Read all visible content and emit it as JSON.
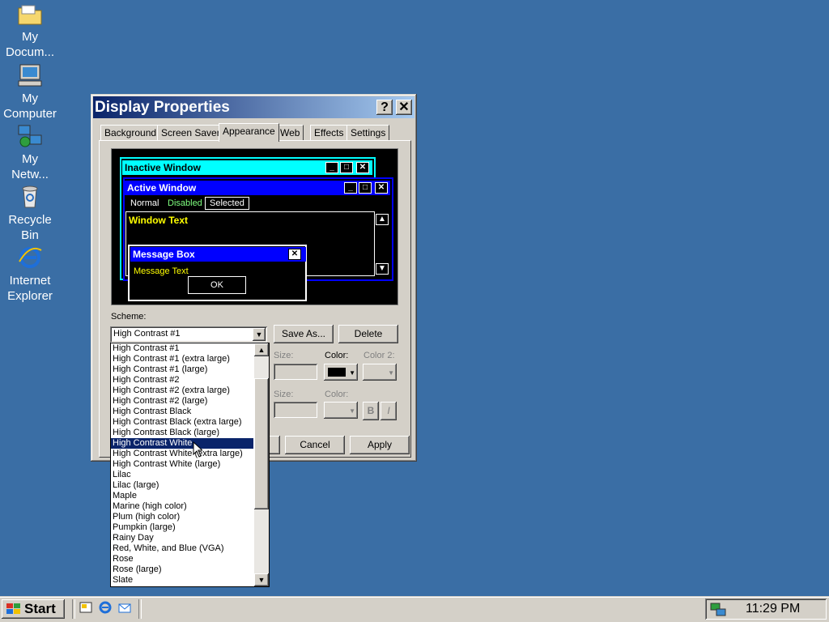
{
  "desktop": {
    "icons": [
      {
        "label_line1": "My",
        "label_line2": "Docum..."
      },
      {
        "label_line1": "My",
        "label_line2": "Computer"
      },
      {
        "label_line1": "My",
        "label_line2": "Netw..."
      },
      {
        "label_line1": "Recycle",
        "label_line2": "Bin"
      },
      {
        "label_line1": "Internet",
        "label_line2": "Explorer"
      }
    ]
  },
  "window": {
    "title": "Display Properties",
    "help_glyph": "?",
    "close_glyph": "✕",
    "tabs": [
      "Background",
      "Screen Saver",
      "Appearance",
      "Web",
      "Effects",
      "Settings"
    ],
    "active_tab": "Appearance"
  },
  "preview": {
    "inactive_title": "Inactive Window",
    "active_title": "Active Window",
    "menu_normal": "Normal",
    "menu_disabled": "Disabled",
    "menu_selected": "Selected",
    "window_text": "Window Text",
    "msgbox_title": "Message Box",
    "msgbox_text": "Message Text",
    "ok_label": "OK",
    "colors": {
      "inactive_title_bg": "#00ffff",
      "active_title_bg": "#0000ff",
      "text_yellow": "#ffff00",
      "bg": "#000000"
    }
  },
  "scheme": {
    "label": "Scheme:",
    "selected_value": "High Contrast #1",
    "save_as_label": "Save As...",
    "delete_label": "Delete",
    "options": [
      "High Contrast #1",
      "High Contrast #1 (extra large)",
      "High Contrast #1 (large)",
      "High Contrast #2",
      "High Contrast #2 (extra large)",
      "High Contrast #2 (large)",
      "High Contrast Black",
      "High Contrast Black (extra large)",
      "High Contrast Black (large)",
      "High Contrast White",
      "High Contrast White (extra large)",
      "High Contrast White (large)",
      "Lilac",
      "Lilac (large)",
      "Maple",
      "Marine (high color)",
      "Plum (high color)",
      "Pumpkin (large)",
      "Rainy Day",
      "Red, White, and Blue (VGA)",
      "Rose",
      "Rose (large)",
      "Slate"
    ],
    "highlighted_option": "High Contrast White"
  },
  "item_row": {
    "size_label": "Size:",
    "color_label": "Color:",
    "color2_label": "Color 2:"
  },
  "font_row": {
    "size_label": "Size:",
    "color_label": "Color:",
    "bold_label": "B",
    "italic_label": "I"
  },
  "footer": {
    "cancel_label": "Cancel",
    "apply_label": "Apply"
  },
  "taskbar": {
    "start_label": "Start",
    "clock": "11:29 PM"
  }
}
